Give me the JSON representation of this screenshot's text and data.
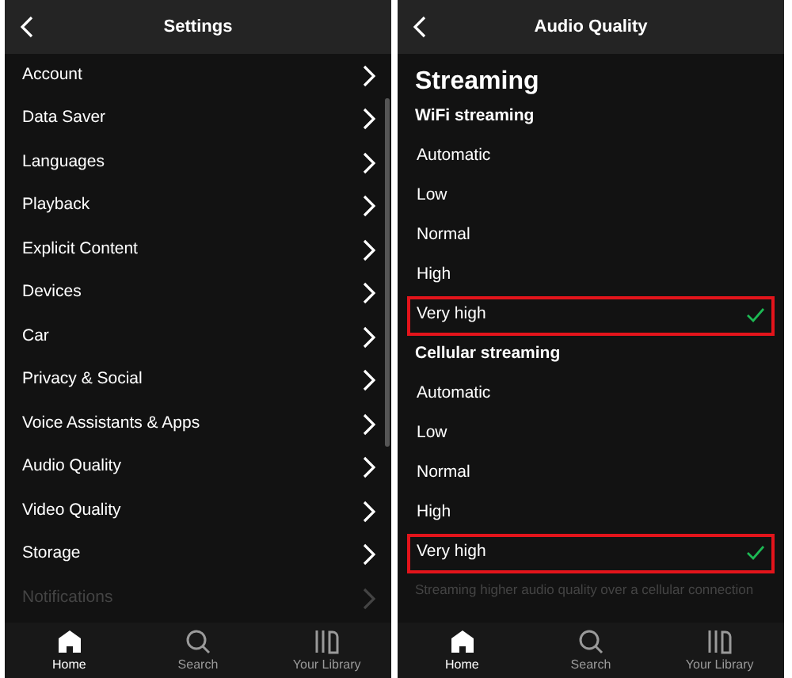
{
  "settings_screen": {
    "title": "Settings",
    "items": [
      {
        "label": "Account",
        "dimmed": false
      },
      {
        "label": "Data Saver",
        "dimmed": false
      },
      {
        "label": "Languages",
        "dimmed": false
      },
      {
        "label": "Playback",
        "dimmed": false
      },
      {
        "label": "Explicit Content",
        "dimmed": false
      },
      {
        "label": "Devices",
        "dimmed": false
      },
      {
        "label": "Car",
        "dimmed": false
      },
      {
        "label": "Privacy & Social",
        "dimmed": false
      },
      {
        "label": "Voice Assistants & Apps",
        "dimmed": false
      },
      {
        "label": "Audio Quality",
        "dimmed": false
      },
      {
        "label": "Video Quality",
        "dimmed": false
      },
      {
        "label": "Storage",
        "dimmed": false
      },
      {
        "label": "Notifications",
        "dimmed": true
      }
    ],
    "nav": [
      {
        "label": "Home",
        "kind": "home",
        "selected": true
      },
      {
        "label": "Search",
        "kind": "search",
        "selected": false
      },
      {
        "label": "Your Library",
        "kind": "library",
        "selected": false
      }
    ]
  },
  "audio_screen": {
    "title": "Audio Quality",
    "heading": "Streaming",
    "groups": [
      {
        "title": "WiFi streaming",
        "options": [
          {
            "label": "Automatic",
            "selected": false,
            "highlighted": false
          },
          {
            "label": "Low",
            "selected": false,
            "highlighted": false
          },
          {
            "label": "Normal",
            "selected": false,
            "highlighted": false
          },
          {
            "label": "High",
            "selected": false,
            "highlighted": false
          },
          {
            "label": "Very high",
            "selected": true,
            "highlighted": true
          }
        ]
      },
      {
        "title": "Cellular streaming",
        "options": [
          {
            "label": "Automatic",
            "selected": false,
            "highlighted": false
          },
          {
            "label": "Low",
            "selected": false,
            "highlighted": false
          },
          {
            "label": "Normal",
            "selected": false,
            "highlighted": false
          },
          {
            "label": "High",
            "selected": false,
            "highlighted": false
          },
          {
            "label": "Very high",
            "selected": true,
            "highlighted": true
          }
        ]
      }
    ],
    "footnote": "Streaming higher audio quality over a cellular connection",
    "nav": [
      {
        "label": "Home",
        "kind": "home",
        "selected": true
      },
      {
        "label": "Search",
        "kind": "search",
        "selected": false
      },
      {
        "label": "Your Library",
        "kind": "library",
        "selected": false
      }
    ]
  }
}
